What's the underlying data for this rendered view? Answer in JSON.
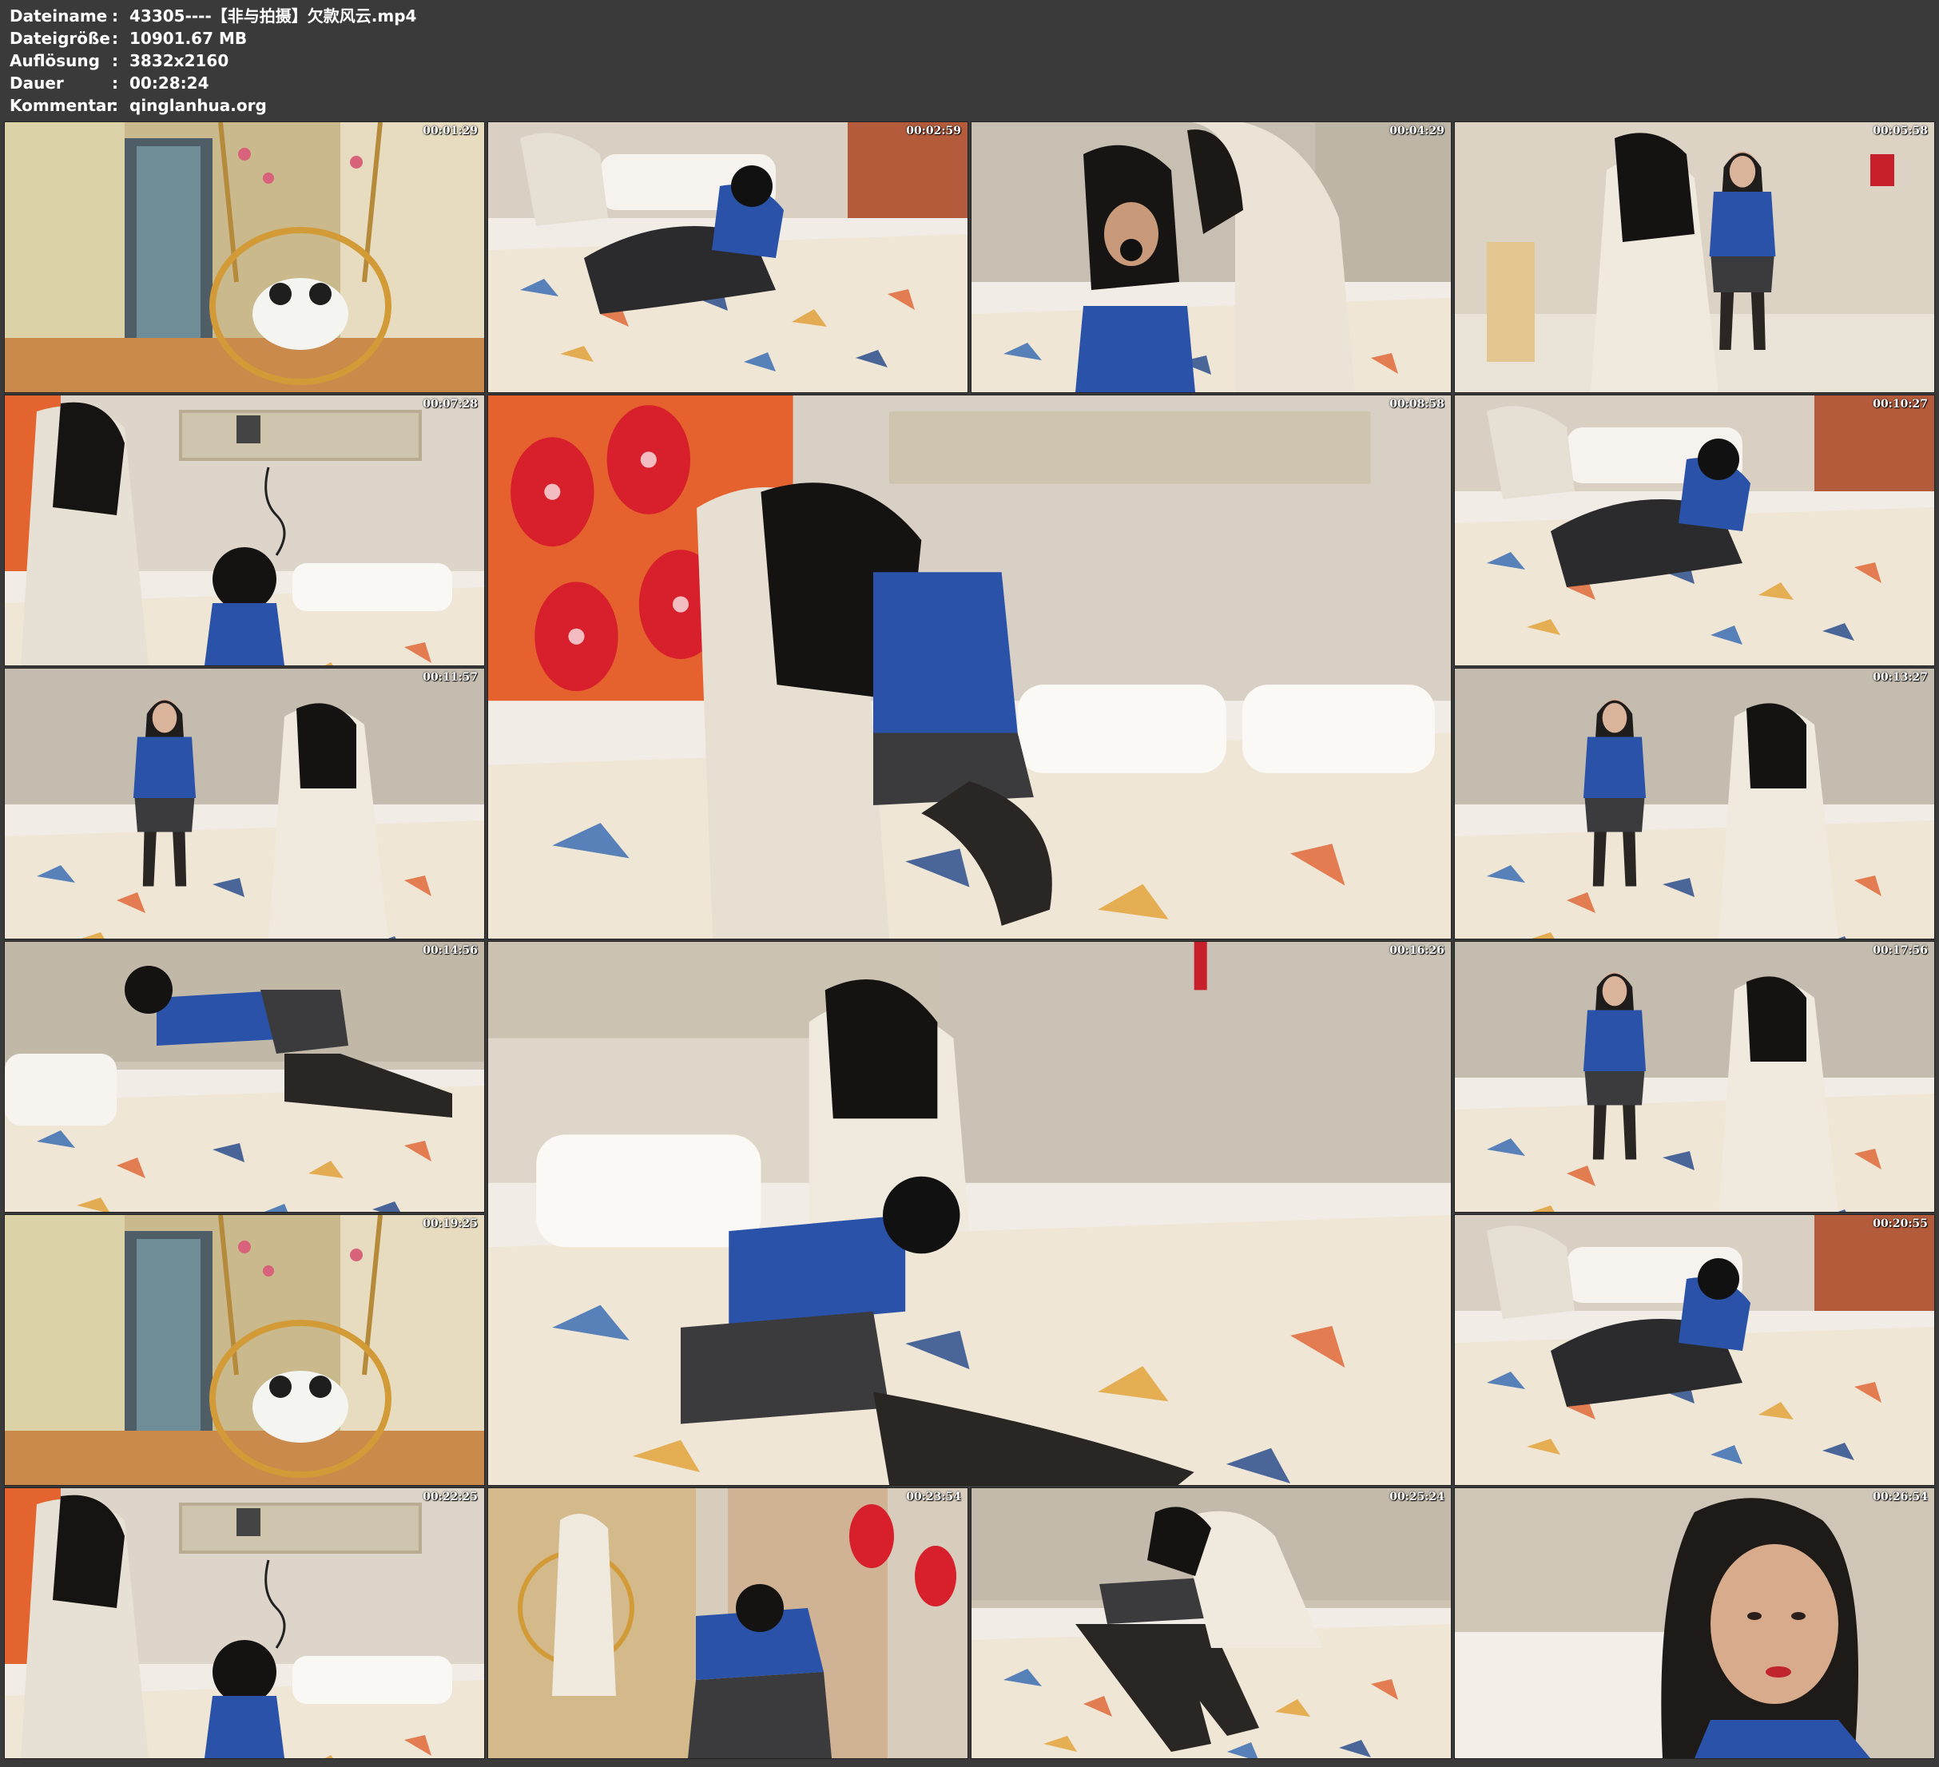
{
  "info": [
    {
      "label": "Dateiname",
      "value": "43305----【非与拍摄】欠款风云.mp4"
    },
    {
      "label": "Dateigröße",
      "value": "10901.67 MB"
    },
    {
      "label": "Auflösung",
      "value": "3832x2160"
    },
    {
      "label": "Dauer",
      "value": "00:28:24"
    },
    {
      "label": "Kommentar",
      "value": "qinglanhua.org"
    }
  ],
  "separator": ":",
  "thumbnails": [
    {
      "timestamp": "00:01:29",
      "scene": "hallway-hanging-chair"
    },
    {
      "timestamp": "00:02:59",
      "scene": "bed-two-persons"
    },
    {
      "timestamp": "00:04:29",
      "scene": "bed-closeup"
    },
    {
      "timestamp": "00:05:58",
      "scene": "standing-two-persons"
    },
    {
      "timestamp": "00:07:28",
      "scene": "bedroom-wall-shelf"
    },
    {
      "timestamp": "00:08:58",
      "scene": "lanterns-bed-large"
    },
    {
      "timestamp": "00:10:27",
      "scene": "bed-two-persons"
    },
    {
      "timestamp": "00:11:57",
      "scene": "bed-sitting"
    },
    {
      "timestamp": "00:13:27",
      "scene": "bed-sitting"
    },
    {
      "timestamp": "00:14:56",
      "scene": "bed-kneeling"
    },
    {
      "timestamp": "00:16:26",
      "scene": "bed-two-persons-large"
    },
    {
      "timestamp": "00:17:56",
      "scene": "bed-sitting"
    },
    {
      "timestamp": "00:19:25",
      "scene": "hallway-hanging-chair"
    },
    {
      "timestamp": "00:20:55",
      "scene": "bed-two-persons"
    },
    {
      "timestamp": "00:22:25",
      "scene": "bedroom-wall-shelf"
    },
    {
      "timestamp": "00:23:54",
      "scene": "lanterns-room"
    },
    {
      "timestamp": "00:25:24",
      "scene": "bed-lying"
    },
    {
      "timestamp": "00:26:54",
      "scene": "face-closeup"
    }
  ],
  "colors": {
    "background": "#3a3a3a",
    "text": "#ffffff"
  }
}
